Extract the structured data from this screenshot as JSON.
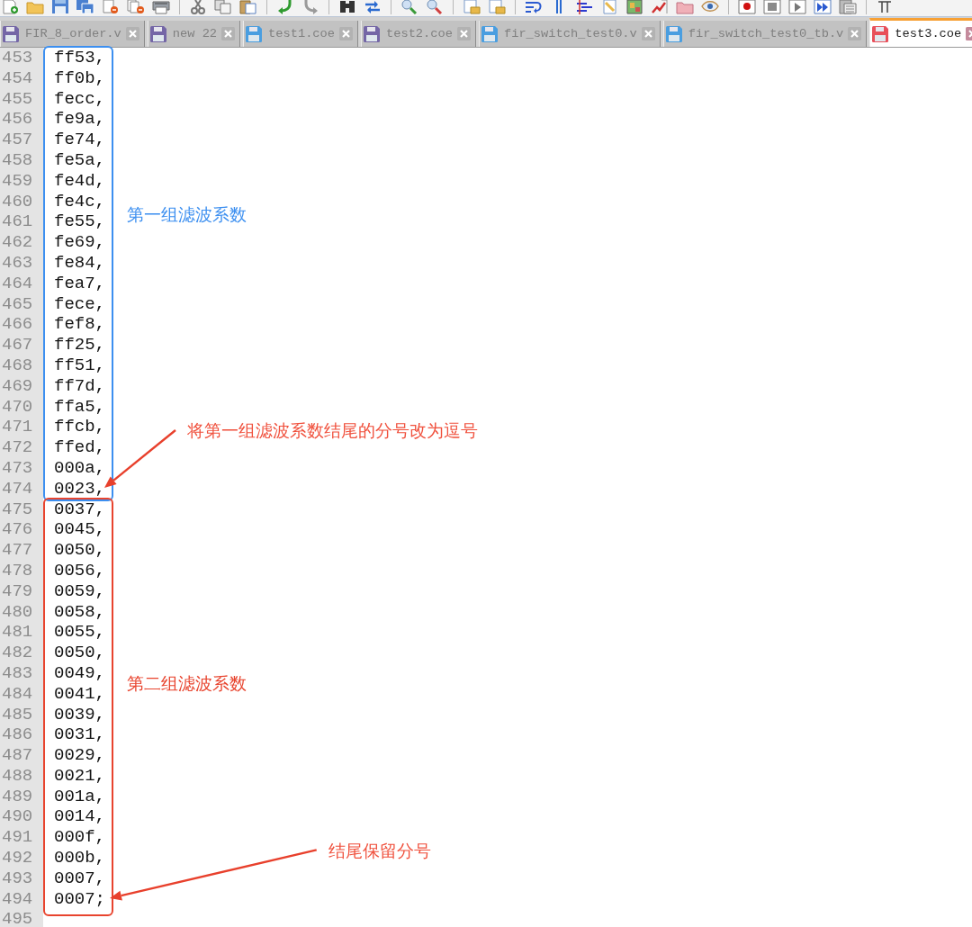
{
  "tabs": [
    {
      "label": "FIR_8_order.v",
      "selected": false,
      "color": "#7466a6"
    },
    {
      "label": "new 22",
      "selected": false,
      "color": "#7466a6"
    },
    {
      "label": "test1.coe",
      "selected": false,
      "color": "#4a9ee0"
    },
    {
      "label": "test2.coe",
      "selected": false,
      "color": "#7466a6"
    },
    {
      "label": "fir_switch_test0.v",
      "selected": false,
      "color": "#4a9ee0"
    },
    {
      "label": "fir_switch_test0_tb.v",
      "selected": false,
      "color": "#4a9ee0"
    },
    {
      "label": "test3.coe",
      "selected": true,
      "color": "#e8505a"
    }
  ],
  "editor": {
    "groups": [
      {
        "label": "第一组滤波系数",
        "color": "#3c8ff0",
        "callout": "将第一组滤波系数结尾的分号改为逗号",
        "lines": [
          {
            "number": "453",
            "text": "ff53,"
          },
          {
            "number": "454",
            "text": "ff0b,"
          },
          {
            "number": "455",
            "text": "fecc,"
          },
          {
            "number": "456",
            "text": "fe9a,"
          },
          {
            "number": "457",
            "text": "fe74,"
          },
          {
            "number": "458",
            "text": "fe5a,"
          },
          {
            "number": "459",
            "text": "fe4d,"
          },
          {
            "number": "460",
            "text": "fe4c,"
          },
          {
            "number": "461",
            "text": "fe55,"
          },
          {
            "number": "462",
            "text": "fe69,"
          },
          {
            "number": "463",
            "text": "fe84,"
          },
          {
            "number": "464",
            "text": "fea7,"
          },
          {
            "number": "465",
            "text": "fece,"
          },
          {
            "number": "466",
            "text": "fef8,"
          },
          {
            "number": "467",
            "text": "ff25,"
          },
          {
            "number": "468",
            "text": "ff51,"
          },
          {
            "number": "469",
            "text": "ff7d,"
          },
          {
            "number": "470",
            "text": "ffa5,"
          },
          {
            "number": "471",
            "text": "ffcb,"
          },
          {
            "number": "472",
            "text": "ffed,"
          },
          {
            "number": "473",
            "text": "000a,"
          },
          {
            "number": "474",
            "text": "0023,"
          }
        ]
      },
      {
        "label": "第二组滤波系数",
        "color": "#e8442e",
        "callout": "结尾保留分号",
        "lines": [
          {
            "number": "475",
            "text": "0037,"
          },
          {
            "number": "476",
            "text": "0045,"
          },
          {
            "number": "477",
            "text": "0050,"
          },
          {
            "number": "478",
            "text": "0056,"
          },
          {
            "number": "479",
            "text": "0059,"
          },
          {
            "number": "480",
            "text": "0058,"
          },
          {
            "number": "481",
            "text": "0055,"
          },
          {
            "number": "482",
            "text": "0050,"
          },
          {
            "number": "483",
            "text": "0049,"
          },
          {
            "number": "484",
            "text": "0041,"
          },
          {
            "number": "485",
            "text": "0039,"
          },
          {
            "number": "486",
            "text": "0031,"
          },
          {
            "number": "487",
            "text": "0029,"
          },
          {
            "number": "488",
            "text": "0021,"
          },
          {
            "number": "489",
            "text": "001a,"
          },
          {
            "number": "490",
            "text": "0014,"
          },
          {
            "number": "491",
            "text": "000f,"
          },
          {
            "number": "492",
            "text": "000b,"
          },
          {
            "number": "493",
            "text": "0007,"
          },
          {
            "number": "494",
            "text": "0007;"
          }
        ]
      }
    ],
    "trailing_lines": [
      {
        "number": "495"
      }
    ]
  }
}
